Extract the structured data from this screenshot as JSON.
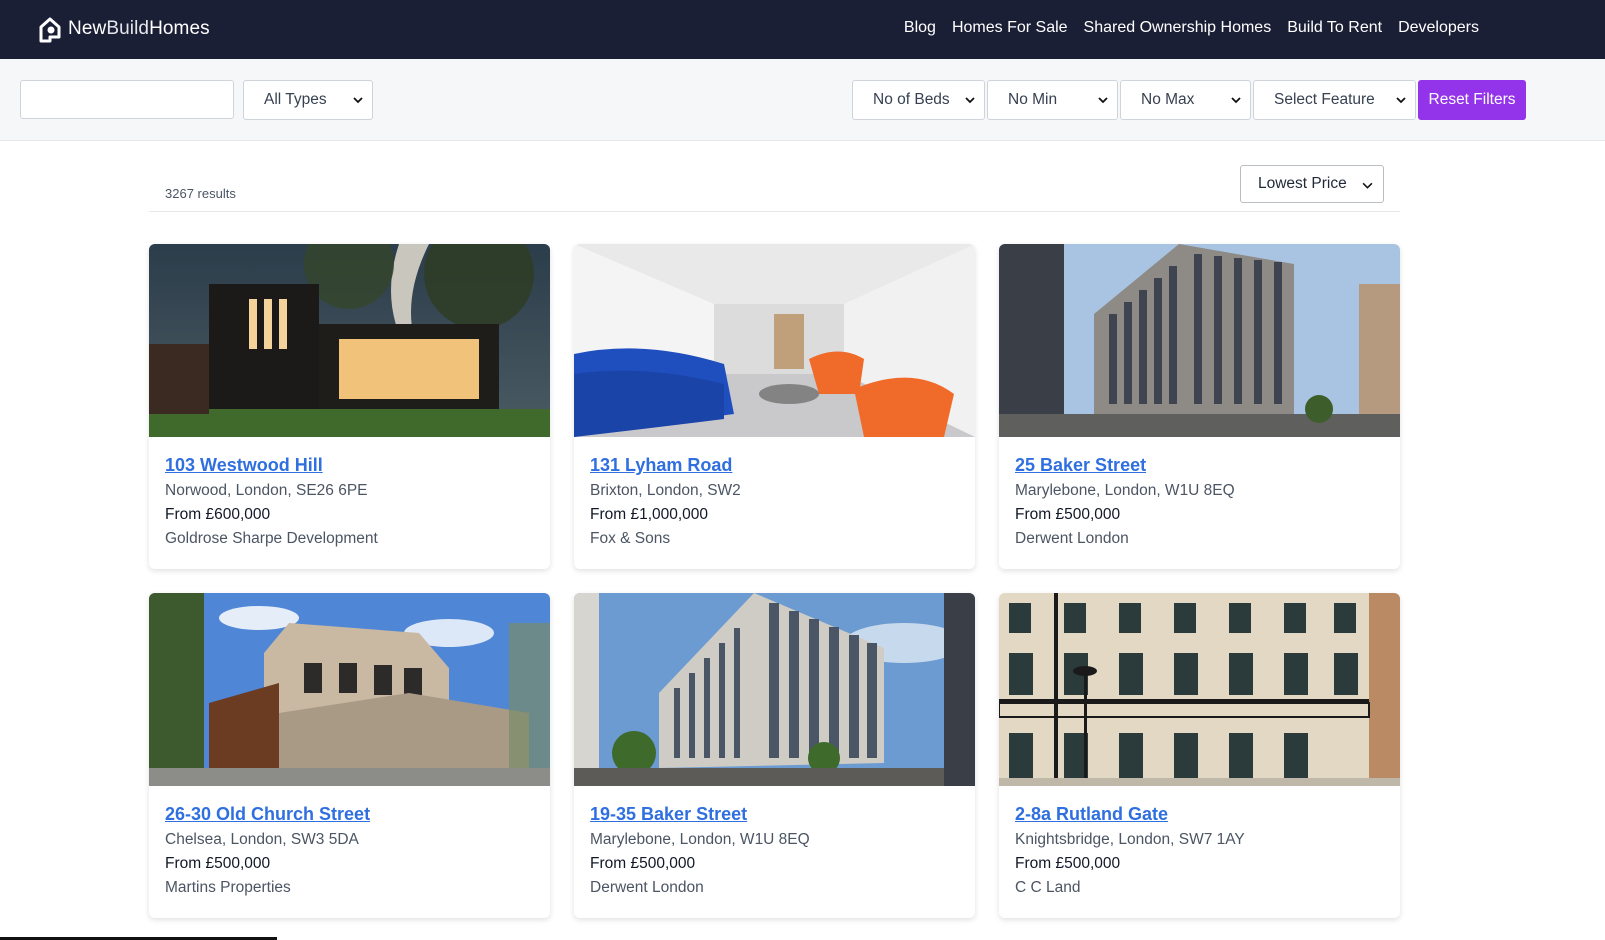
{
  "brand": {
    "name_part1": "New",
    "name_part2": "Build",
    "name_part3": "Homes"
  },
  "nav": [
    {
      "label": "Blog"
    },
    {
      "label": "Homes For Sale"
    },
    {
      "label": "Shared Ownership Homes"
    },
    {
      "label": "Build To Rent"
    },
    {
      "label": "Developers"
    }
  ],
  "filters": {
    "search_value": "",
    "type": "All Types",
    "beds": "No of Beds",
    "min": "No Min",
    "max": "No Max",
    "feature": "Select Feature",
    "reset_label": "Reset Filters"
  },
  "results": {
    "count_text": "3267 results",
    "sort": "Lowest Price"
  },
  "listings": [
    {
      "title": "103 Westwood Hill",
      "location": "Norwood, London, SE26 6PE",
      "price": "From £600,000",
      "developer": "Goldrose Sharpe Development",
      "image": "modern-house-night"
    },
    {
      "title": "131 Lyham Road",
      "location": "Brixton, London, SW2",
      "price": "From £1,000,000",
      "developer": "Fox & Sons",
      "image": "interior-living-room"
    },
    {
      "title": "25 Baker Street",
      "location": "Marylebone, London, W1U 8EQ",
      "price": "From £500,000",
      "developer": "Derwent London",
      "image": "office-block-street"
    },
    {
      "title": "26-30 Old Church Street",
      "location": "Chelsea, London, SW3 5DA",
      "price": "From £500,000",
      "developer": "Martins Properties",
      "image": "brick-townhouses"
    },
    {
      "title": "19-35 Baker Street",
      "location": "Marylebone, London, W1U 8EQ",
      "price": "From £500,000",
      "developer": "Derwent London",
      "image": "office-block-corner"
    },
    {
      "title": "2-8a Rutland Gate",
      "location": "Knightsbridge, London, SW7 1AY",
      "price": "From £500,000",
      "developer": "C C Land",
      "image": "georgian-terrace"
    }
  ],
  "colors": {
    "header_bg": "#1b1f36",
    "accent": "#9333ea",
    "link": "#2f6fe0"
  }
}
